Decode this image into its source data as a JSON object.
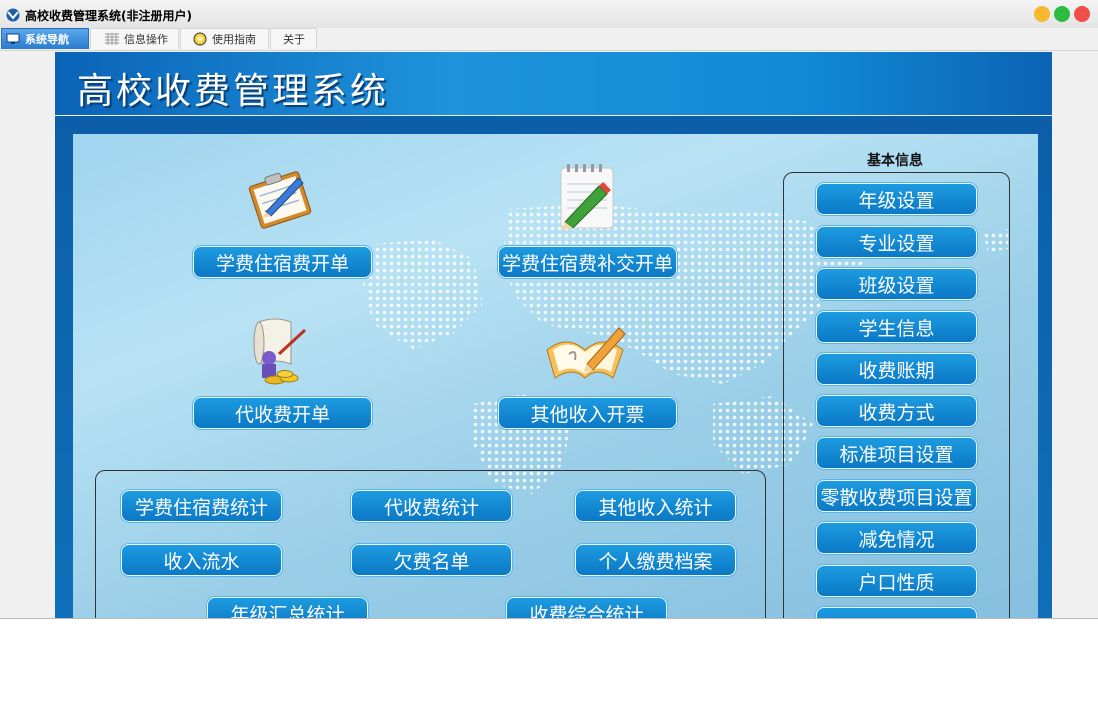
{
  "window": {
    "title": "高校收费管理系统(非注册用户)",
    "controls": [
      {
        "name": "minimize-button",
        "color": "#f5b82e"
      },
      {
        "name": "maximize-button",
        "color": "#2cbd40"
      },
      {
        "name": "close-button",
        "color": "#f04e48"
      }
    ]
  },
  "tabs": [
    {
      "label": "系统导航",
      "icon": "monitor-icon",
      "active": true
    },
    {
      "label": "信息操作",
      "icon": "grid-icon",
      "active": false
    },
    {
      "label": "使用指南",
      "icon": "help-icon",
      "active": false
    },
    {
      "label": "关于",
      "icon": "",
      "active": false
    }
  ],
  "banner": {
    "title": "高校收费管理系统"
  },
  "main_actions": [
    {
      "label": "学费住宿费开单",
      "icon": "clipboard-pencil-icon"
    },
    {
      "label": "学费住宿费补交开单",
      "icon": "notepad-pencil-icon"
    },
    {
      "label": "代收费开单",
      "icon": "scroll-money-icon"
    },
    {
      "label": "其他收入开票",
      "icon": "open-book-pencil-icon"
    }
  ],
  "statistics": [
    {
      "label": "学费住宿费统计"
    },
    {
      "label": "代收费统计"
    },
    {
      "label": "其他收入统计"
    },
    {
      "label": "收入流水"
    },
    {
      "label": "欠费名单"
    },
    {
      "label": "个人缴费档案"
    },
    {
      "label": "年级汇总统计"
    },
    {
      "label": "收费综合统计"
    }
  ],
  "basic_info": {
    "title": "基本信息",
    "items": [
      {
        "label": "年级设置"
      },
      {
        "label": "专业设置"
      },
      {
        "label": "班级设置"
      },
      {
        "label": "学生信息"
      },
      {
        "label": "收费账期"
      },
      {
        "label": "收费方式"
      },
      {
        "label": "标准项目设置"
      },
      {
        "label": "零散收费项目设置"
      },
      {
        "label": "减免情况"
      },
      {
        "label": "户口性质"
      }
    ]
  },
  "colors": {
    "button_gradient_top": "#1d9be0",
    "button_gradient_bottom": "#0b78c6",
    "banner_blue": "#118ad6",
    "content_bg": "#b8e2f4"
  }
}
